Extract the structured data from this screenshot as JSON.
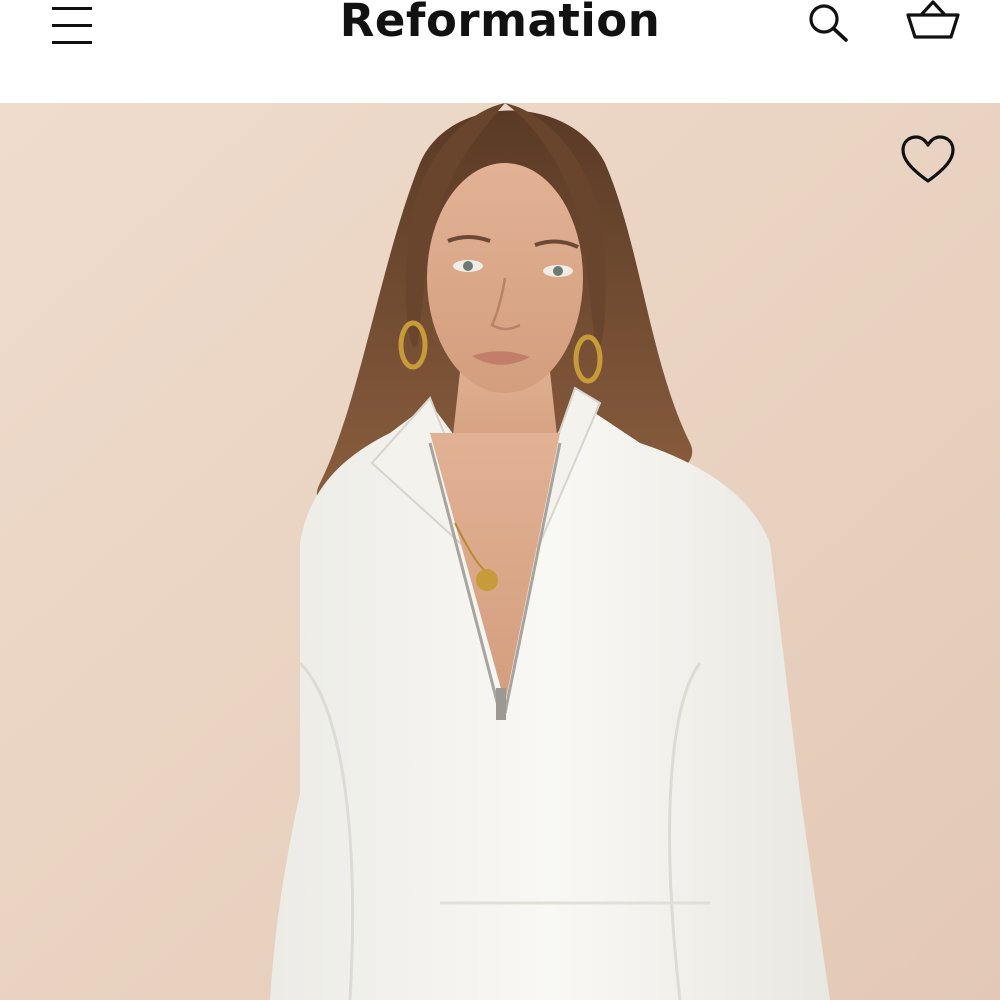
{
  "header": {
    "brand": "Reformation",
    "menu_icon": "hamburger-menu-icon",
    "search_icon": "search-icon",
    "bag_icon": "shopping-basket-icon"
  },
  "product_image": {
    "wishlist_icon": "heart-outline-icon",
    "background_color": "#ecd8c8",
    "garment_color": "#f6f4ef",
    "hair_color": "#6b4a32"
  }
}
